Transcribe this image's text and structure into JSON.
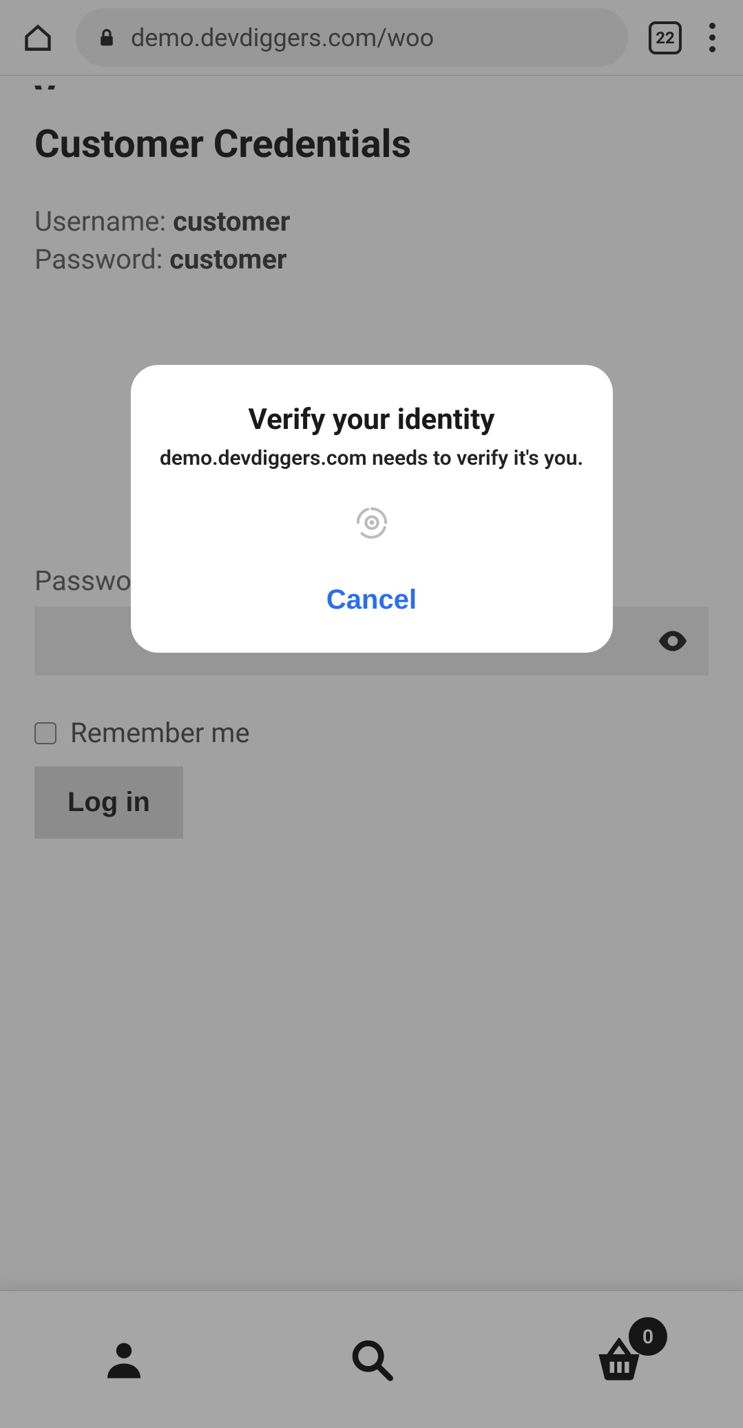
{
  "browser": {
    "url": "demo.devdiggers.com/woo",
    "tab_count": "22"
  },
  "page": {
    "heading": "Customer Credentials",
    "username_label": "Username: ",
    "username_value": "customer",
    "password_label": "Password: ",
    "password_value": "customer",
    "form": {
      "password_field_label": "Password ",
      "required_mark": "*",
      "remember_label": "Remember me",
      "login_button": "Log in"
    }
  },
  "bottom_nav": {
    "cart_count": "0"
  },
  "dialog": {
    "title": "Verify your identity",
    "subtitle": "demo.devdiggers.com needs to verify it's you.",
    "cancel": "Cancel"
  }
}
